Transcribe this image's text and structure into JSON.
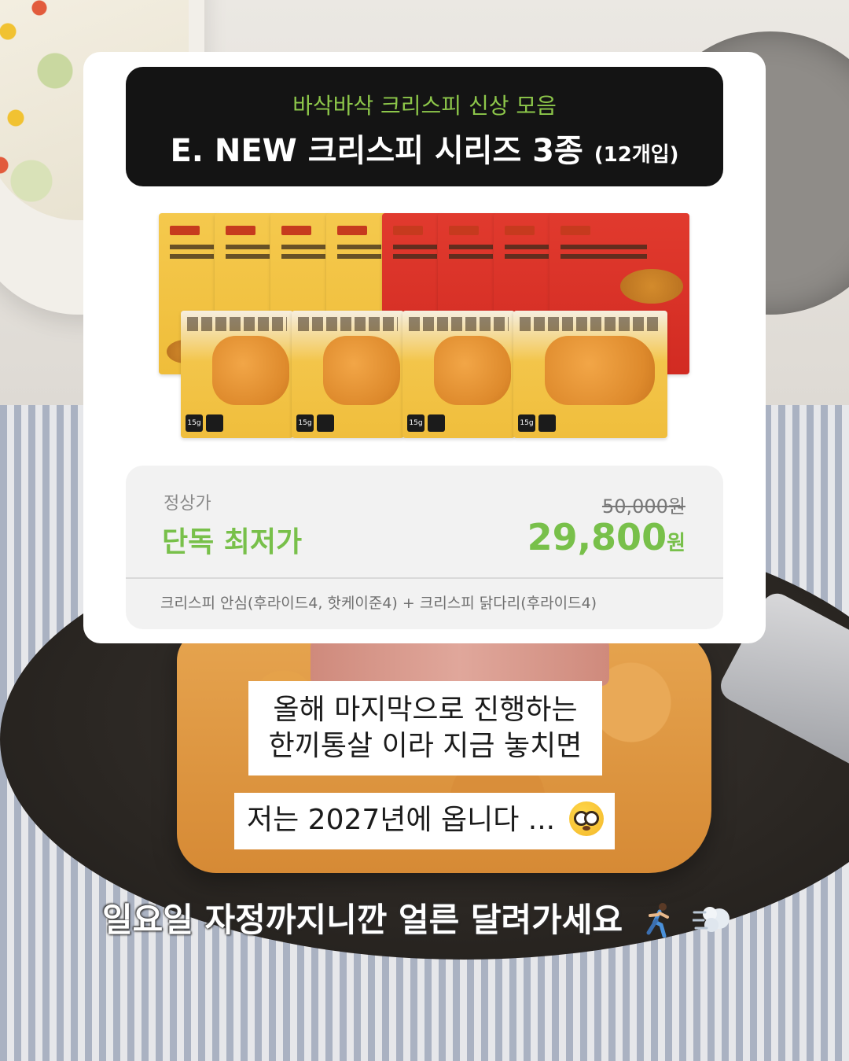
{
  "header": {
    "subtitle": "바삭바삭 크리스피 신상 모음",
    "title": "E. NEW 크리스피 시리즈 3종",
    "count": "(12개입)"
  },
  "packs": {
    "badge_text": "15g"
  },
  "price": {
    "regular_label": "정상가",
    "best_label": "단독 최저가",
    "original": "50,000원",
    "sale": "29,800",
    "sale_unit": "원",
    "contents": "크리스피 안심(후라이드4, 핫케이준4) + 크리스피 닭다리(후라이드4)"
  },
  "captions": {
    "line1": "올해 마지막으로 진행하는",
    "line2": "한끼통살 이라 지금 놓치면",
    "line3": "저는 2027년에 옵니다 ...",
    "bottom": "일요일 자정까지니깐 얼른 달려가세요"
  },
  "icons": {
    "flushed": "flushed-face-icon",
    "runner": "running-person-icon",
    "dash": "dashing-away-icon"
  },
  "colors": {
    "accent_green": "#78c04a",
    "banner_dark": "#141414"
  }
}
